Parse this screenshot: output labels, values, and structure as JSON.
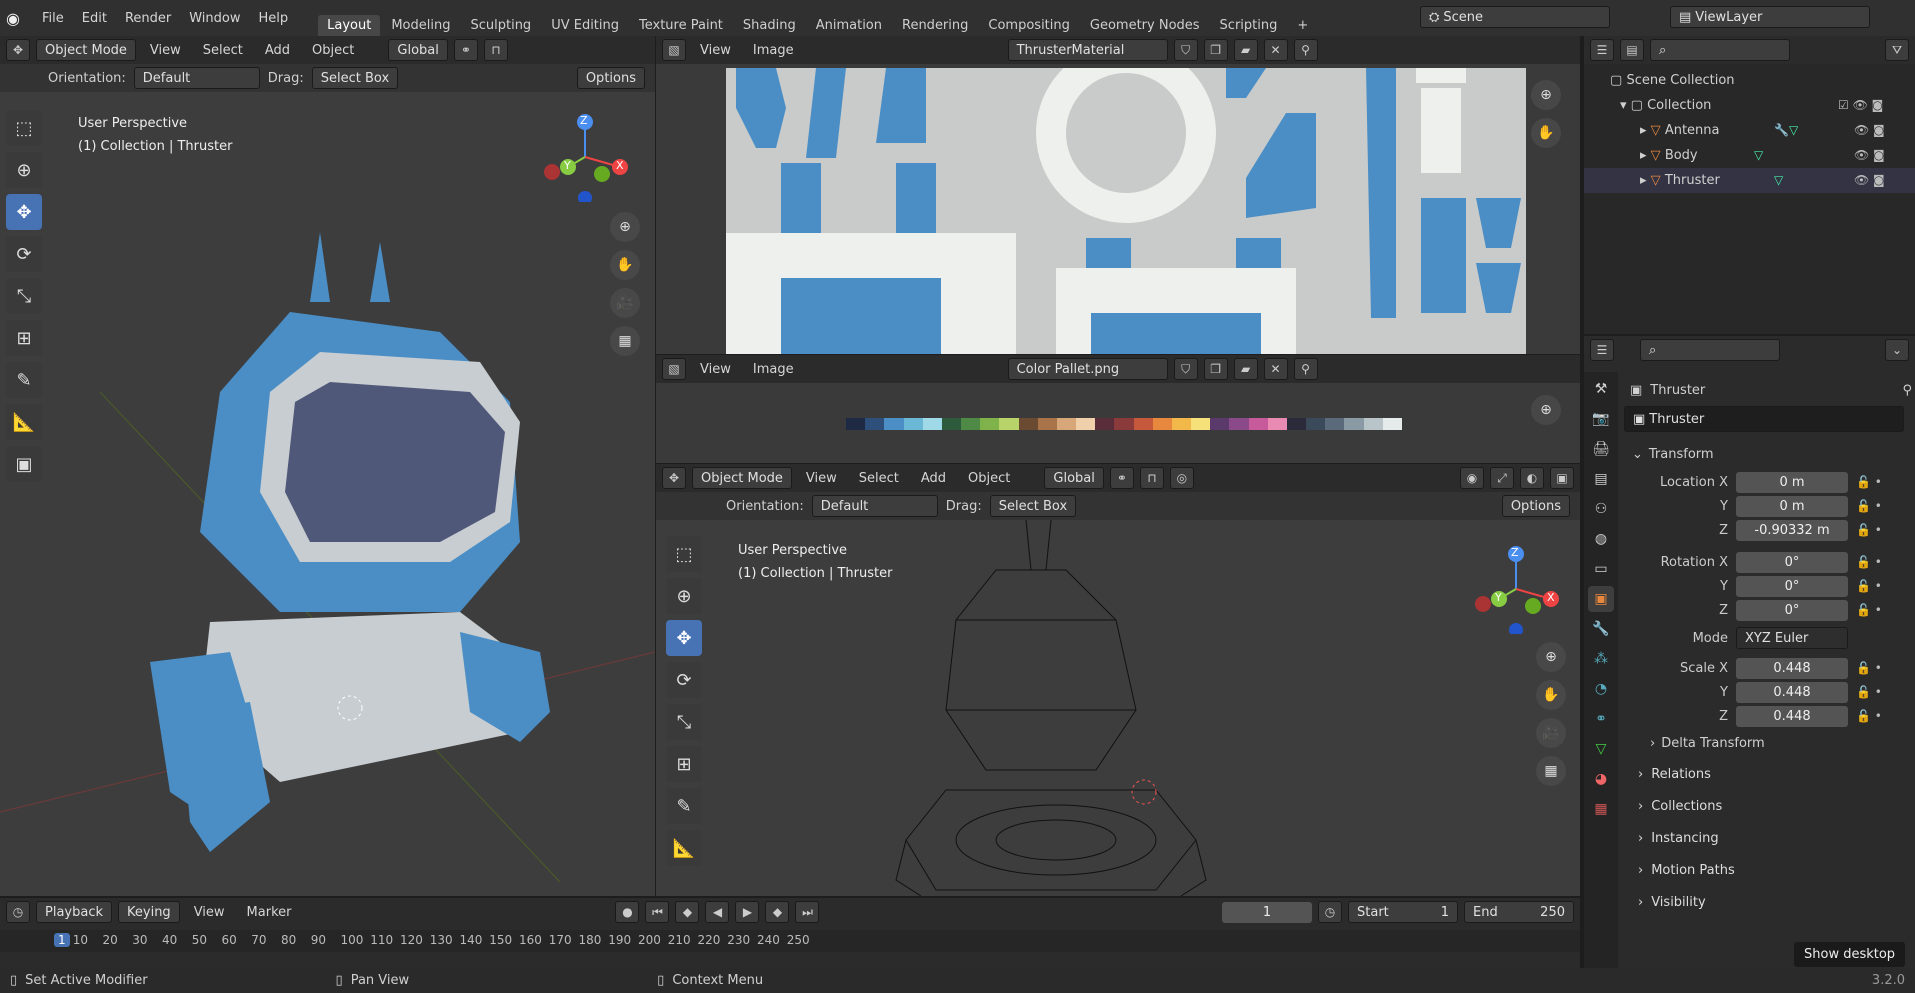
{
  "topbar": {
    "menus": [
      "File",
      "Edit",
      "Render",
      "Window",
      "Help"
    ],
    "workspaces": [
      "Layout",
      "Modeling",
      "Sculpting",
      "UV Editing",
      "Texture Paint",
      "Shading",
      "Animation",
      "Rendering",
      "Compositing",
      "Geometry Nodes",
      "Scripting"
    ],
    "add_tab": "+",
    "scene": "Scene",
    "view_layer": "ViewLayer"
  },
  "viewport_left": {
    "mode": "Object Mode",
    "menus": [
      "View",
      "Select",
      "Add",
      "Object"
    ],
    "transform_space": "Global",
    "orientation_label": "Orientation:",
    "orientation": "Default",
    "drag_label": "Drag:",
    "drag": "Select Box",
    "options": "Options",
    "perspective": "User Perspective",
    "collection": "(1) Collection | Thruster",
    "axes": {
      "x": "X",
      "y": "Y",
      "z": "Z"
    }
  },
  "image_editor_top": {
    "menus": [
      "View",
      "Image"
    ],
    "image": "ThrusterMaterial"
  },
  "image_editor_mid": {
    "menus": [
      "View",
      "Image"
    ],
    "image": "Color Pallet.png"
  },
  "viewport_right": {
    "mode": "Object Mode",
    "menus": [
      "View",
      "Select",
      "Add",
      "Object"
    ],
    "transform_space": "Global",
    "orientation_label": "Orientation:",
    "orientation": "Default",
    "drag_label": "Drag:",
    "drag": "Select Box",
    "options": "Options",
    "perspective": "User Perspective",
    "collection": "(1) Collection | Thruster",
    "axes": {
      "x": "X",
      "y": "Y",
      "z": "Z"
    }
  },
  "outliner": {
    "items": [
      {
        "label": "Scene Collection"
      },
      {
        "label": "Collection"
      },
      {
        "label": "Antenna"
      },
      {
        "label": "Body"
      },
      {
        "label": "Thruster"
      }
    ]
  },
  "properties": {
    "object_name": "Thruster",
    "data_name": "Thruster",
    "transform_label": "Transform",
    "location": {
      "label": "Location X",
      "x": "0 m",
      "y": "0 m",
      "z": "-0.90332 m"
    },
    "rotation": {
      "label": "Rotation X",
      "x": "0°",
      "y": "0°",
      "z": "0°"
    },
    "mode_label": "Mode",
    "mode": "XYZ Euler",
    "scale": {
      "label": "Scale X",
      "x": "0.448",
      "y": "0.448",
      "z": "0.448"
    },
    "axis_y": "Y",
    "axis_z": "Z",
    "delta": "Delta Transform",
    "sections": [
      "Relations",
      "Collections",
      "Instancing",
      "Motion Paths",
      "Visibility"
    ]
  },
  "timeline": {
    "menus": [
      "Playback",
      "Keying",
      "View",
      "Marker"
    ],
    "current_frame": "1",
    "start_label": "Start",
    "start": "1",
    "end_label": "End",
    "end": "250",
    "ruler": [
      "1",
      "10",
      "20",
      "30",
      "40",
      "50",
      "60",
      "70",
      "80",
      "90",
      "100",
      "110",
      "120",
      "130",
      "140",
      "150",
      "160",
      "170",
      "180",
      "190",
      "200",
      "210",
      "220",
      "230",
      "240",
      "250"
    ]
  },
  "statusbar": {
    "left": "Set Active Modifier",
    "mid": "Pan View",
    "right": "Context Menu",
    "version": "3.2.0"
  },
  "tooltip": "Show desktop",
  "colors": {
    "accent": "#4772b3",
    "object_blue": "#4a8ec5",
    "palette": [
      "#1e2a44",
      "#2d4f7a",
      "#4a8ec5",
      "#6ab7d6",
      "#9fd8e6",
      "#2d5a3a",
      "#4e8a45",
      "#7fb24a",
      "#b7d36a",
      "#6b4a32",
      "#a87348",
      "#d8a779",
      "#efd0ab",
      "#5a2d3a",
      "#8a3a3a",
      "#c6593c",
      "#e8883f",
      "#f2b84a",
      "#f6e07a",
      "#5a3a6b",
      "#8a4a8a",
      "#c65a9a",
      "#e88ab2",
      "#2a2a3a",
      "#3a4a5a",
      "#5a6a7a",
      "#8a9aa5",
      "#b8c4c8",
      "#e5ebea"
    ]
  }
}
